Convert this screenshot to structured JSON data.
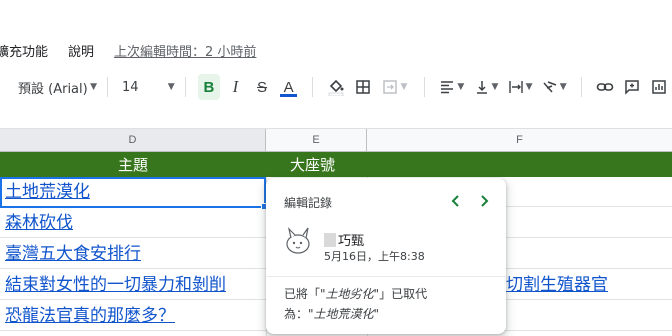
{
  "menu": {
    "items": [
      "擴充功能",
      "說明"
    ],
    "last_edit": "上次編輯時間：2 小時前"
  },
  "toolbar": {
    "font": "預設 (Arial)",
    "font_size": "14",
    "bold": "B",
    "italic": "I",
    "strike": "S",
    "text_color": "A",
    "text_color_hex": "#1155cc"
  },
  "columns": [
    "D",
    "E",
    "F"
  ],
  "header_row": {
    "d": "主題",
    "e": "大座號",
    "bg_color": "#38761d"
  },
  "rows": [
    {
      "d": "土地荒漠化",
      "f": ""
    },
    {
      "d": "森林砍伐",
      "f": ""
    },
    {
      "d": "臺灣五大食安排行",
      "f": ""
    },
    {
      "d": "結束對女性的一切暴力和剝削",
      "f": "切割生殖器官"
    },
    {
      "d": "恐龍法官真的那麼多？",
      "f": ""
    }
  ],
  "edit_history": {
    "title": "編輯記錄",
    "user": "巧甄",
    "time": "5月16日，上午8:38",
    "change_line1_prefix": "已將「",
    "change_old": "\"土地劣化\"",
    "change_line1_suffix": "」已取代",
    "change_line2_prefix": "為：",
    "change_new": "\"土地荒漠化\""
  }
}
